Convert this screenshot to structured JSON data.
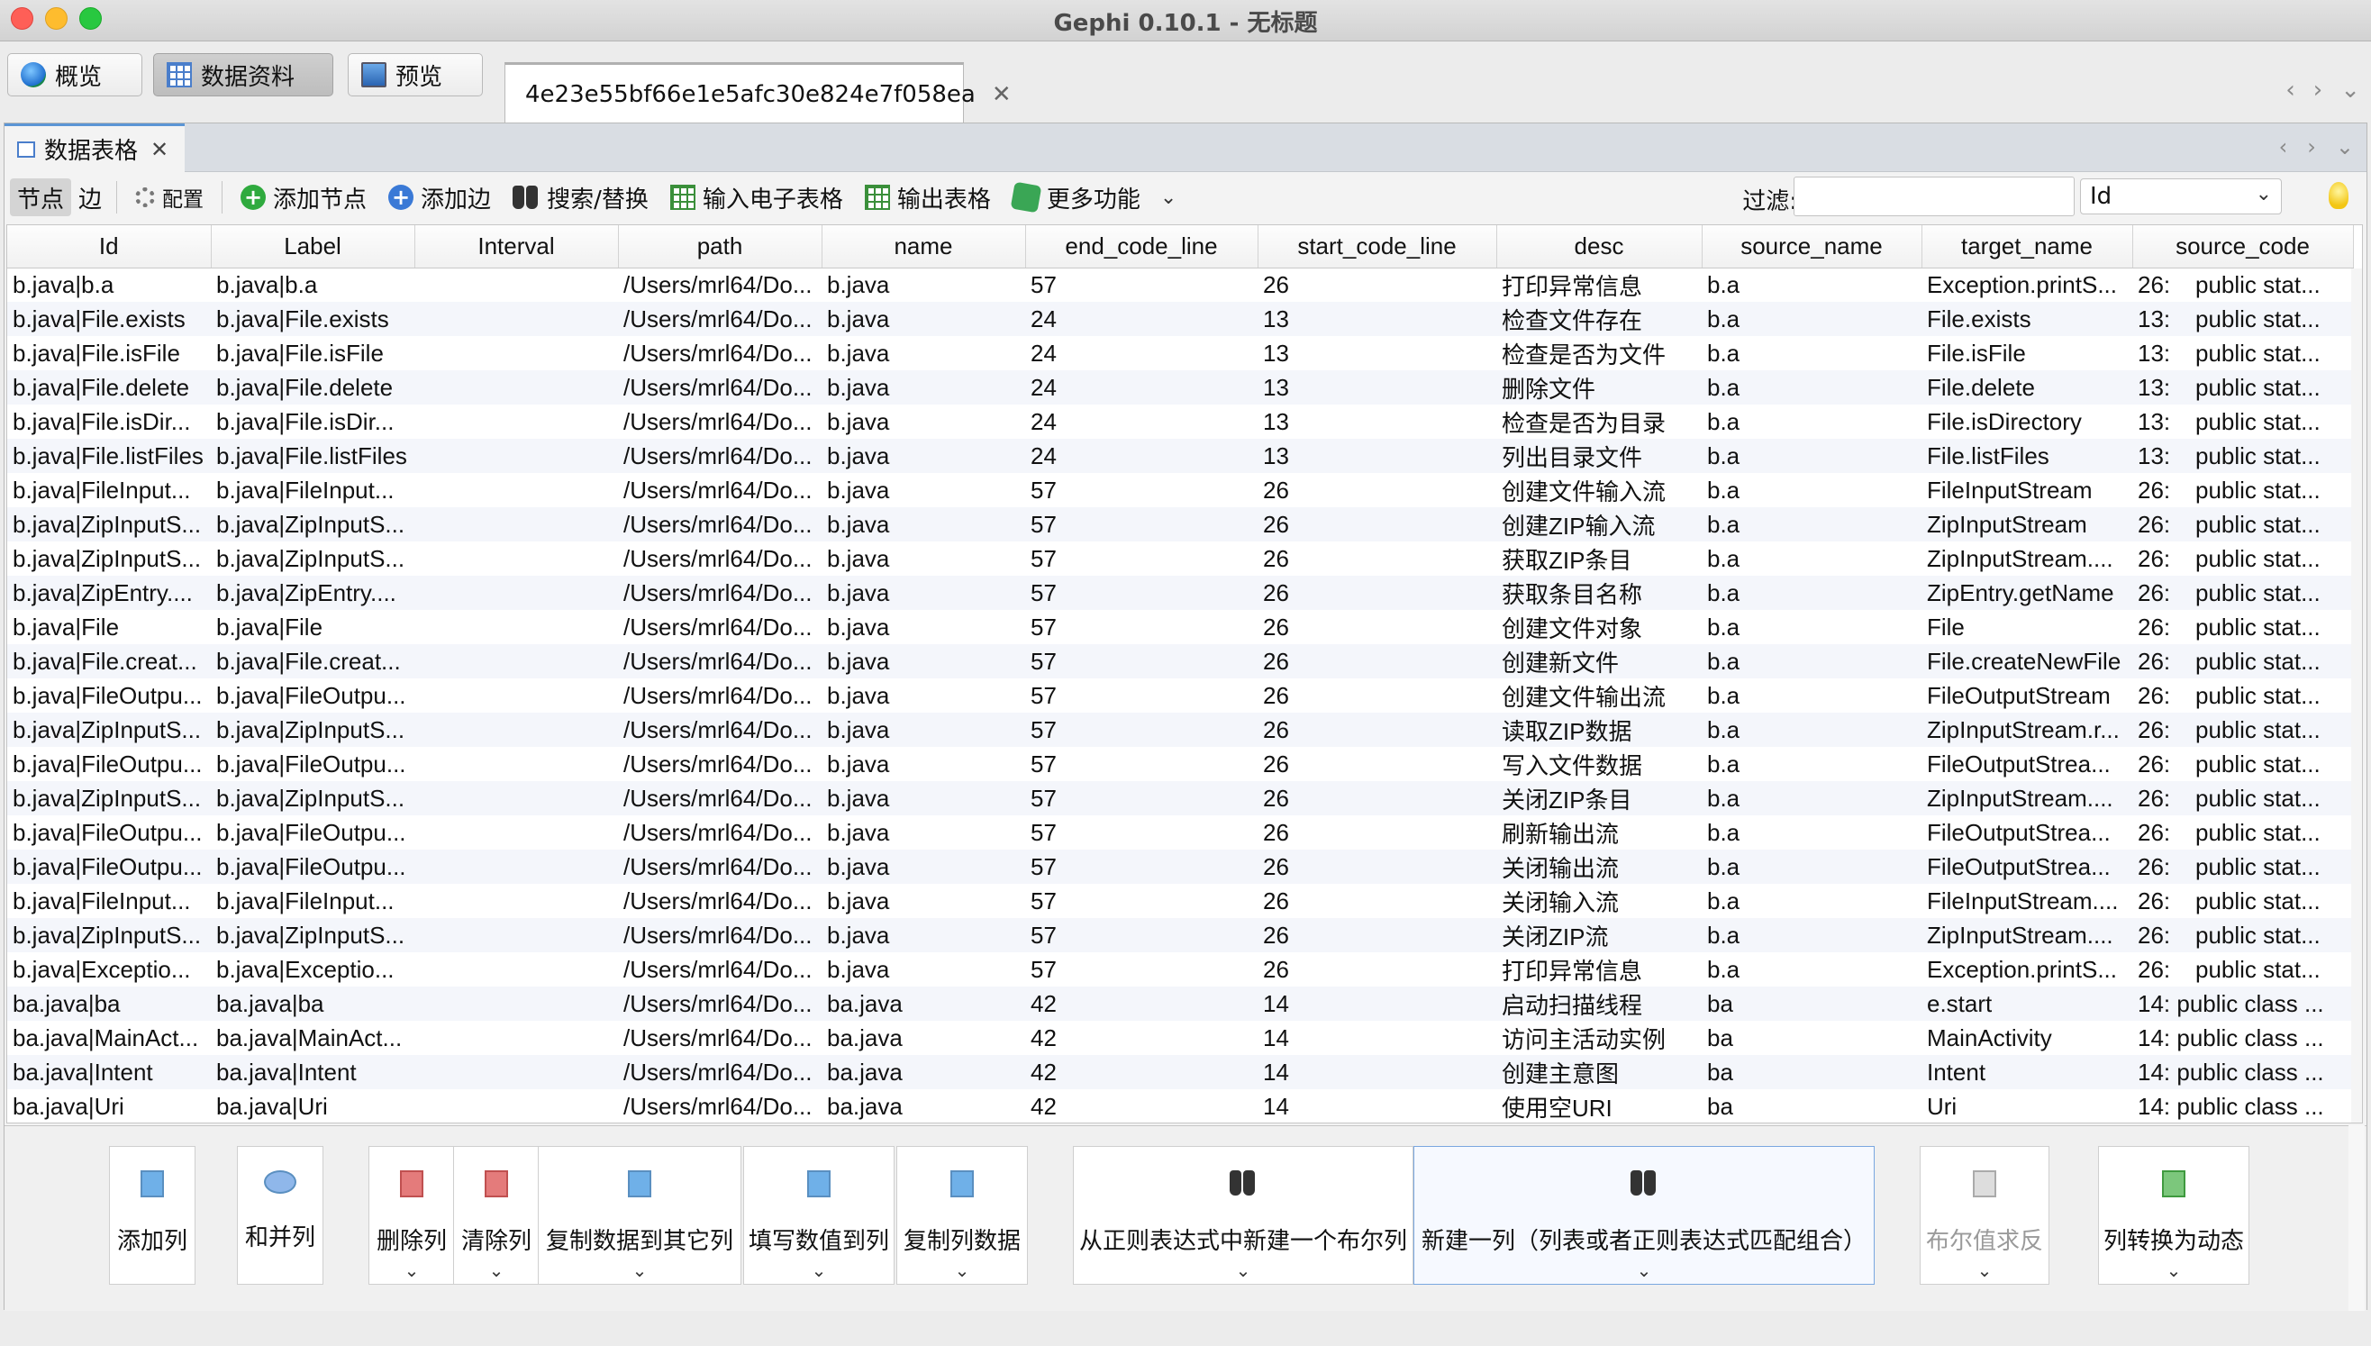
{
  "window": {
    "title": "Gephi 0.10.1 - 无标题"
  },
  "mode_tabs": [
    "概览",
    "数据资料",
    "预览"
  ],
  "document_tab": "4e23e55bf66e1e5afc30e824e7f058ea",
  "panel": {
    "title": "数据表格"
  },
  "toolbar": {
    "nodes": "节点",
    "edges": "边",
    "config": "配置",
    "add_node": "添加节点",
    "add_edge": "添加边",
    "search_replace": "搜索/替换",
    "import_spreadsheet": "输入电子表格",
    "export_table": "输出表格",
    "more": "更多功能",
    "filter_label": "过滤:",
    "filter_value": "",
    "filter_column": "Id"
  },
  "columns": [
    "Id",
    "Label",
    "Interval",
    "path",
    "name",
    "end_code_line",
    "start_code_line",
    "desc",
    "source_name",
    "target_name",
    "source_code"
  ],
  "rows": [
    [
      "b.java|b.a",
      "b.java|b.a",
      "",
      "/Users/mrl64/Do...",
      "b.java",
      "57",
      "26",
      "打印异常信息",
      "b.a",
      "Exception.printS...",
      "26:",
      "public stat..."
    ],
    [
      "b.java|File.exists",
      "b.java|File.exists",
      "",
      "/Users/mrl64/Do...",
      "b.java",
      "24",
      "13",
      "检查文件存在",
      "b.a",
      "File.exists",
      "13:",
      "public stat..."
    ],
    [
      "b.java|File.isFile",
      "b.java|File.isFile",
      "",
      "/Users/mrl64/Do...",
      "b.java",
      "24",
      "13",
      "检查是否为文件",
      "b.a",
      "File.isFile",
      "13:",
      "public stat..."
    ],
    [
      "b.java|File.delete",
      "b.java|File.delete",
      "",
      "/Users/mrl64/Do...",
      "b.java",
      "24",
      "13",
      "删除文件",
      "b.a",
      "File.delete",
      "13:",
      "public stat..."
    ],
    [
      "b.java|File.isDir...",
      "b.java|File.isDir...",
      "",
      "/Users/mrl64/Do...",
      "b.java",
      "24",
      "13",
      "检查是否为目录",
      "b.a",
      "File.isDirectory",
      "13:",
      "public stat..."
    ],
    [
      "b.java|File.listFiles",
      "b.java|File.listFiles",
      "",
      "/Users/mrl64/Do...",
      "b.java",
      "24",
      "13",
      "列出目录文件",
      "b.a",
      "File.listFiles",
      "13:",
      "public stat..."
    ],
    [
      "b.java|FileInput...",
      "b.java|FileInput...",
      "",
      "/Users/mrl64/Do...",
      "b.java",
      "57",
      "26",
      "创建文件输入流",
      "b.a",
      "FileInputStream",
      "26:",
      "public stat..."
    ],
    [
      "b.java|ZipInputS...",
      "b.java|ZipInputS...",
      "",
      "/Users/mrl64/Do...",
      "b.java",
      "57",
      "26",
      "创建ZIP输入流",
      "b.a",
      "ZipInputStream",
      "26:",
      "public stat..."
    ],
    [
      "b.java|ZipInputS...",
      "b.java|ZipInputS...",
      "",
      "/Users/mrl64/Do...",
      "b.java",
      "57",
      "26",
      "获取ZIP条目",
      "b.a",
      "ZipInputStream....",
      "26:",
      "public stat..."
    ],
    [
      "b.java|ZipEntry....",
      "b.java|ZipEntry....",
      "",
      "/Users/mrl64/Do...",
      "b.java",
      "57",
      "26",
      "获取条目名称",
      "b.a",
      "ZipEntry.getName",
      "26:",
      "public stat..."
    ],
    [
      "b.java|File",
      "b.java|File",
      "",
      "/Users/mrl64/Do...",
      "b.java",
      "57",
      "26",
      "创建文件对象",
      "b.a",
      "File",
      "26:",
      "public stat..."
    ],
    [
      "b.java|File.creat...",
      "b.java|File.creat...",
      "",
      "/Users/mrl64/Do...",
      "b.java",
      "57",
      "26",
      "创建新文件",
      "b.a",
      "File.createNewFile",
      "26:",
      "public stat..."
    ],
    [
      "b.java|FileOutpu...",
      "b.java|FileOutpu...",
      "",
      "/Users/mrl64/Do...",
      "b.java",
      "57",
      "26",
      "创建文件输出流",
      "b.a",
      "FileOutputStream",
      "26:",
      "public stat..."
    ],
    [
      "b.java|ZipInputS...",
      "b.java|ZipInputS...",
      "",
      "/Users/mrl64/Do...",
      "b.java",
      "57",
      "26",
      "读取ZIP数据",
      "b.a",
      "ZipInputStream.r...",
      "26:",
      "public stat..."
    ],
    [
      "b.java|FileOutpu...",
      "b.java|FileOutpu...",
      "",
      "/Users/mrl64/Do...",
      "b.java",
      "57",
      "26",
      "写入文件数据",
      "b.a",
      "FileOutputStrea...",
      "26:",
      "public stat..."
    ],
    [
      "b.java|ZipInputS...",
      "b.java|ZipInputS...",
      "",
      "/Users/mrl64/Do...",
      "b.java",
      "57",
      "26",
      "关闭ZIP条目",
      "b.a",
      "ZipInputStream....",
      "26:",
      "public stat..."
    ],
    [
      "b.java|FileOutpu...",
      "b.java|FileOutpu...",
      "",
      "/Users/mrl64/Do...",
      "b.java",
      "57",
      "26",
      "刷新输出流",
      "b.a",
      "FileOutputStrea...",
      "26:",
      "public stat..."
    ],
    [
      "b.java|FileOutpu...",
      "b.java|FileOutpu...",
      "",
      "/Users/mrl64/Do...",
      "b.java",
      "57",
      "26",
      "关闭输出流",
      "b.a",
      "FileOutputStrea...",
      "26:",
      "public stat..."
    ],
    [
      "b.java|FileInput...",
      "b.java|FileInput...",
      "",
      "/Users/mrl64/Do...",
      "b.java",
      "57",
      "26",
      "关闭输入流",
      "b.a",
      "FileInputStream....",
      "26:",
      "public stat..."
    ],
    [
      "b.java|ZipInputS...",
      "b.java|ZipInputS...",
      "",
      "/Users/mrl64/Do...",
      "b.java",
      "57",
      "26",
      "关闭ZIP流",
      "b.a",
      "ZipInputStream....",
      "26:",
      "public stat..."
    ],
    [
      "b.java|Exceptio...",
      "b.java|Exceptio...",
      "",
      "/Users/mrl64/Do...",
      "b.java",
      "57",
      "26",
      "打印异常信息",
      "b.a",
      "Exception.printS...",
      "26:",
      "public stat..."
    ],
    [
      "ba.java|ba",
      "ba.java|ba",
      "",
      "/Users/mrl64/Do...",
      "ba.java",
      "42",
      "14",
      "启动扫描线程",
      "ba",
      "e.start",
      "14: public class ...",
      ""
    ],
    [
      "ba.java|MainAct...",
      "ba.java|MainAct...",
      "",
      "/Users/mrl64/Do...",
      "ba.java",
      "42",
      "14",
      "访问主活动实例",
      "ba",
      "MainActivity",
      "14: public class ...",
      ""
    ],
    [
      "ba.java|Intent",
      "ba.java|Intent",
      "",
      "/Users/mrl64/Do...",
      "ba.java",
      "42",
      "14",
      "创建主意图",
      "ba",
      "Intent",
      "14: public class ...",
      ""
    ],
    [
      "ba.java|Uri",
      "ba.java|Uri",
      "",
      "/Users/mrl64/Do...",
      "ba.java",
      "42",
      "14",
      "使用空URI",
      "ba",
      "Uri",
      "14: public class ...",
      ""
    ]
  ],
  "actions": [
    {
      "label": "添加列",
      "dropdown": false
    },
    {
      "label": "和并列",
      "dropdown": false
    },
    {
      "label": "删除列",
      "dropdown": true
    },
    {
      "label": "清除列",
      "dropdown": true
    },
    {
      "label": "复制数据到其它列",
      "dropdown": true
    },
    {
      "label": "填写数值到列",
      "dropdown": true
    },
    {
      "label": "复制列数据",
      "dropdown": true
    },
    {
      "label": "从正则表达式中新建一个布尔列",
      "dropdown": true
    },
    {
      "label": "新建一列（列表或者正则表达式匹配组合）",
      "dropdown": true
    },
    {
      "label": "布尔值求反",
      "dropdown": true,
      "disabled": true
    },
    {
      "label": "列转换为动态",
      "dropdown": true
    }
  ]
}
